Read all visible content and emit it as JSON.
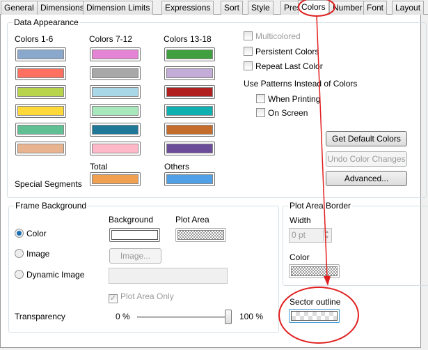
{
  "tabs": [
    "General",
    "Dimensions",
    "Dimension Limits",
    "Expressions",
    "Sort",
    "Style",
    "Presentation",
    "Colors",
    "Number",
    "Font",
    "Layout"
  ],
  "active_tab": "Colors",
  "data_appearance": {
    "title": "Data Appearance",
    "col_headers": [
      "Colors 1-6",
      "Colors 7-12",
      "Colors 13-18"
    ],
    "colors": [
      [
        "#8aa8cc",
        "#ff7060",
        "#b8d44a",
        "#ffd83a",
        "#60c094",
        "#e8b490"
      ],
      [
        "#e484d4",
        "#a8a8a8",
        "#a8d8e8",
        "#a8e8bc",
        "#207898",
        "#ffb8c8"
      ],
      [
        "#40a040",
        "#c4acd8",
        "#b02020",
        "#10b0b0",
        "#c46c2c",
        "#6a4c98"
      ]
    ],
    "special_segments": "Special Segments",
    "total_label": "Total",
    "total_color": "#f0a050",
    "others_label": "Others",
    "others_color": "#50a0e8",
    "multicolored": "Multicolored",
    "persistent_colors": "Persistent Colors",
    "repeat_last_color": "Repeat Last Color",
    "use_patterns": "Use Patterns Instead of Colors",
    "when_printing": "When Printing",
    "on_screen": "On Screen",
    "get_default": "Get Default Colors",
    "undo": "Undo Color Changes",
    "advanced": "Advanced..."
  },
  "frame_background": {
    "title": "Frame Background",
    "background_label": "Background",
    "plot_area_label": "Plot Area",
    "color": "Color",
    "image": "Image",
    "dynamic_image": "Dynamic Image",
    "image_button": "Image...",
    "plot_area_only": "Plot Area Only",
    "transparency": "Transparency",
    "min": "0 %",
    "max": "100 %",
    "transparency_value": 100
  },
  "plot_area_border": {
    "title": "Plot Area Border",
    "width_label": "Width",
    "width_value": "0 pt",
    "color_label": "Color"
  },
  "sector_outline": "Sector outline",
  "annotation_color": "#e02020"
}
